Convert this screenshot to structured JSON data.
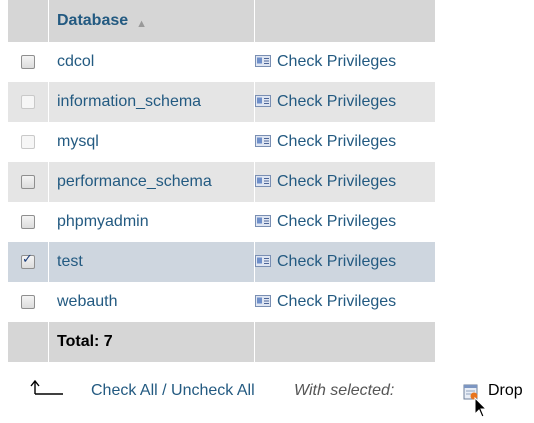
{
  "table": {
    "header": {
      "database": "Database",
      "sort_indicator": "▲"
    },
    "rows": [
      {
        "name": "cdcol",
        "privileges": "Check Privileges",
        "checked": false,
        "disabled": false,
        "state": "odd"
      },
      {
        "name": "information_schema",
        "privileges": "Check Privileges",
        "checked": false,
        "disabled": true,
        "state": "even"
      },
      {
        "name": "mysql",
        "privileges": "Check Privileges",
        "checked": false,
        "disabled": true,
        "state": "odd"
      },
      {
        "name": "performance_schema",
        "privileges": "Check Privileges",
        "checked": false,
        "disabled": false,
        "state": "even"
      },
      {
        "name": "phpmyadmin",
        "privileges": "Check Privileges",
        "checked": false,
        "disabled": false,
        "state": "odd"
      },
      {
        "name": "test",
        "privileges": "Check Privileges",
        "checked": true,
        "disabled": false,
        "state": "selected"
      },
      {
        "name": "webauth",
        "privileges": "Check Privileges",
        "checked": false,
        "disabled": false,
        "state": "odd"
      }
    ],
    "footer": {
      "total": "Total: 7"
    }
  },
  "actions": {
    "check_all": "Check All / Uncheck All",
    "with_selected": "With selected:",
    "drop": "Drop"
  },
  "colors": {
    "link": "#235a81",
    "header_bg": "#d6d6d6",
    "row_alt_bg": "#e5e5e5",
    "row_selected_bg": "#ced6df"
  },
  "icons": {
    "privileges": "privileges-icon",
    "arrow": "arrow-up-left-icon",
    "drop": "drop-icon",
    "cursor": "mouse-cursor-icon"
  }
}
